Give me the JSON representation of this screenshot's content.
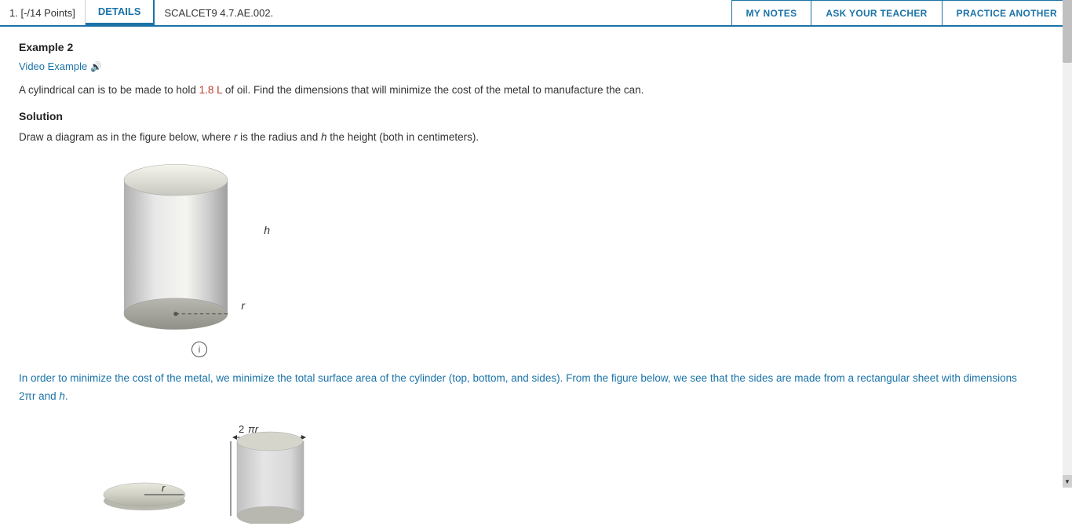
{
  "header": {
    "points_label": "1.  [-/14 Points]",
    "details_label": "DETAILS",
    "scalcet_label": "SCALCET9 4.7.AE.002.",
    "my_notes_label": "MY NOTES",
    "ask_teacher_label": "ASK YOUR TEACHER",
    "practice_another_label": "PRACTICE ANOTHER"
  },
  "content": {
    "example_title": "Example 2",
    "video_link_label": "Video Example",
    "problem_text_part1": "A cylindrical can is to be made to hold ",
    "problem_highlight": "1.8 L",
    "problem_text_part2": " of oil. Find the dimensions that will minimize the cost of the metal to manufacture the can.",
    "solution_title": "Solution",
    "solution_text": "Draw a diagram as in the figure below, where ",
    "r_var": "r",
    "solution_mid": " is the radius and ",
    "h_var": "h",
    "solution_end": " the height (both in centimeters).",
    "h_axis_label": "h",
    "r_axis_label": "r",
    "info_symbol": "i",
    "minimize_text_part1": "In order to minimize the cost of the metal, we minimize the total surface area of the cylinder (top, bottom, and sides). From the figure below, we see that the sides are made from a rectangular sheet with dimensions 2",
    "pi_symbol": "π",
    "minimize_r": "r",
    "minimize_and": " and ",
    "minimize_h": "h",
    "minimize_period": ".",
    "two_pi_r_label": "2πr",
    "r_disk_label": "r",
    "scroll_arrow_up": "▲",
    "scroll_arrow_down": "▼"
  }
}
